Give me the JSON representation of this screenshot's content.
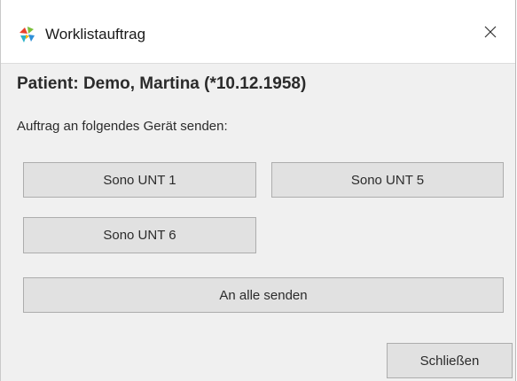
{
  "window": {
    "title": "Worklistauftrag",
    "close_icon": "close-icon",
    "app_icon": "app-logo-icon"
  },
  "patient": {
    "label": "Patient: Demo, Martina (*10.12.1958)"
  },
  "instruction": "Auftrag an folgendes Gerät senden:",
  "devices": {
    "unt1": "Sono UNT 1",
    "unt5": "Sono UNT 5",
    "unt6": "Sono UNT 6"
  },
  "actions": {
    "send_all": "An alle senden",
    "close": "Schließen"
  },
  "colors": {
    "button_bg": "#e1e1e1",
    "button_border": "#adadad",
    "window_bg": "#f0f0f0",
    "titlebar_bg": "#ffffff"
  }
}
